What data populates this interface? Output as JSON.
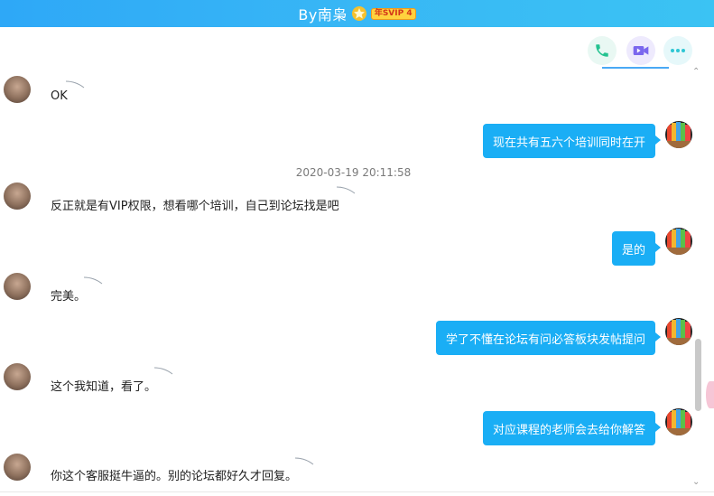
{
  "header": {
    "title": "By南枭",
    "vip_badge": "年SVIP 4"
  },
  "actions": [
    {
      "name": "phone-call-button",
      "icon": "phone-icon",
      "color": "#24c28f"
    },
    {
      "name": "video-call-button",
      "icon": "video-icon",
      "color": "#7b67ee"
    },
    {
      "name": "more-options-button",
      "icon": "more-icon",
      "color": "#2ec6d4"
    }
  ],
  "timestamp": "2020-03-19 20:11:58",
  "messages": [
    {
      "side": "in",
      "text": "OK"
    },
    {
      "side": "out",
      "text": "现在共有五六个培训同时在开"
    },
    {
      "side": "in",
      "text": "反正就是有VIP权限，想看哪个培训，自己到论坛找是吧"
    },
    {
      "side": "out",
      "text": "是的"
    },
    {
      "side": "in",
      "text": "完美。"
    },
    {
      "side": "out",
      "text": "学了不懂在论坛有问必答板块发帖提问"
    },
    {
      "side": "in",
      "text": "这个我知道，看了。"
    },
    {
      "side": "out",
      "text": "对应课程的老师会去给你解答"
    },
    {
      "side": "in",
      "text": "你这个客服挺牛逼的。别的论坛都好久才回复。"
    }
  ],
  "colors": {
    "header": "#35b2f6",
    "bubble": "#1aaef5"
  }
}
